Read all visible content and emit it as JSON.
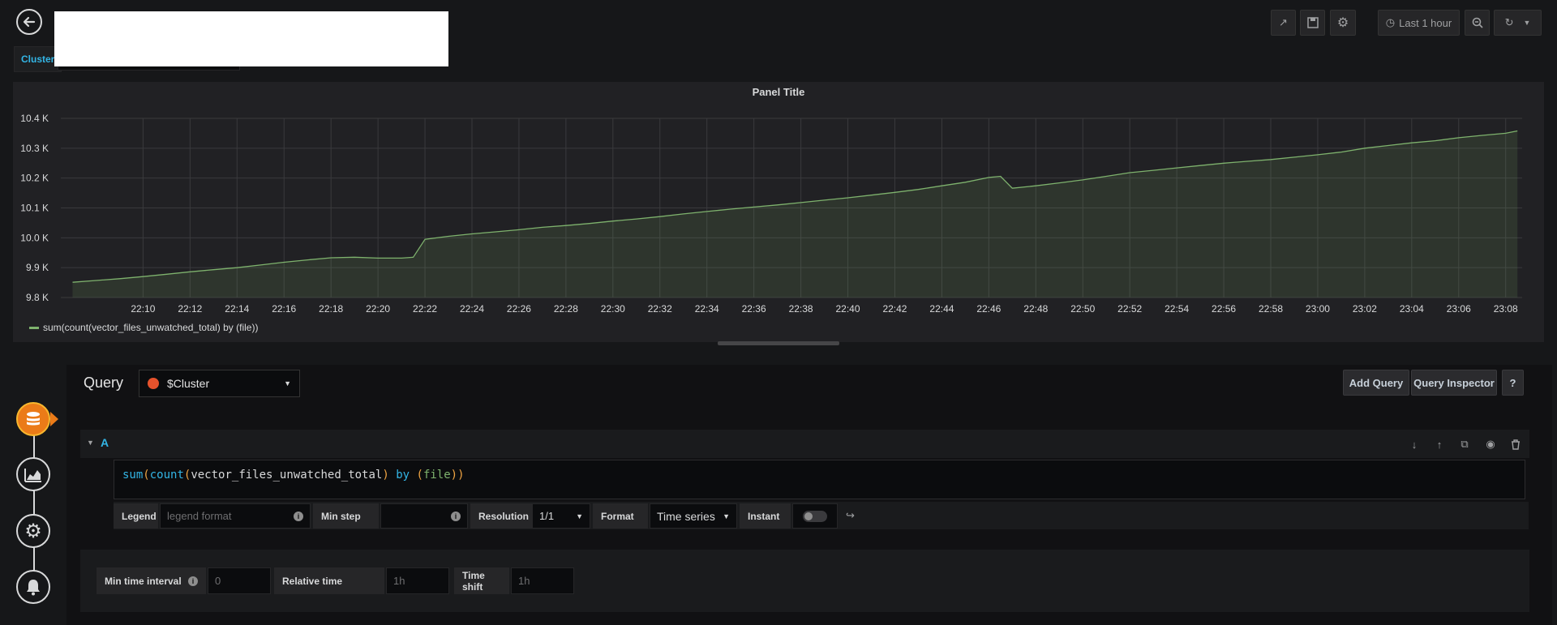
{
  "header": {
    "variable_label": "Cluster",
    "time_range_label": "Last 1 hour"
  },
  "panel": {
    "title": "Panel Title",
    "legend": "sum(count(vector_files_unwatched_total) by (file))"
  },
  "chart_data": {
    "type": "area",
    "title": "Panel Title",
    "y_ticks": [
      "9.8 K",
      "9.9 K",
      "10.0 K",
      "10.1 K",
      "10.2 K",
      "10.3 K",
      "10.4 K"
    ],
    "ylim": [
      9800,
      10400
    ],
    "x_ticks": [
      "22:10",
      "22:12",
      "22:14",
      "22:16",
      "22:18",
      "22:20",
      "22:22",
      "22:24",
      "22:26",
      "22:28",
      "22:30",
      "22:32",
      "22:34",
      "22:36",
      "22:38",
      "22:40",
      "22:42",
      "22:44",
      "22:46",
      "22:48",
      "22:50",
      "22:52",
      "22:54",
      "22:56",
      "22:58",
      "23:00",
      "23:02",
      "23:04",
      "23:06",
      "23:08"
    ],
    "grid": true,
    "legend_position": "bottom-left",
    "series": [
      {
        "name": "sum(count(vector_files_unwatched_total) by (file))",
        "color": "#7eb26d",
        "x": [
          "22:07",
          "22:08",
          "22:09",
          "22:10",
          "22:11",
          "22:12",
          "22:13",
          "22:14",
          "22:15",
          "22:16",
          "22:17",
          "22:18",
          "22:19",
          "22:20",
          "22:21",
          "22:21:30",
          "22:22",
          "22:23",
          "22:24",
          "22:25",
          "22:26",
          "22:27",
          "22:28",
          "22:29",
          "22:30",
          "22:31",
          "22:32",
          "22:33",
          "22:34",
          "22:35",
          "22:36",
          "22:37",
          "22:38",
          "22:39",
          "22:40",
          "22:41",
          "22:42",
          "22:43",
          "22:44",
          "22:45",
          "22:46",
          "22:46:30",
          "22:47",
          "22:48",
          "22:49",
          "22:50",
          "22:51",
          "22:52",
          "22:53",
          "22:54",
          "22:55",
          "22:56",
          "22:57",
          "22:58",
          "22:59",
          "23:00",
          "23:01",
          "23:02",
          "23:03",
          "23:04",
          "23:05",
          "23:06",
          "23:07",
          "23:08",
          "23:08:30"
        ],
        "values": [
          9851,
          9857,
          9863,
          9870,
          9878,
          9886,
          9893,
          9900,
          9909,
          9918,
          9926,
          9933,
          9935,
          9932,
          9932,
          9935,
          9995,
          10005,
          10013,
          10020,
          10027,
          10035,
          10041,
          10048,
          10056,
          10063,
          10071,
          10080,
          10088,
          10096,
          10103,
          10110,
          10118,
          10126,
          10134,
          10143,
          10152,
          10162,
          10174,
          10186,
          10202,
          10206,
          10166,
          10174,
          10184,
          10194,
          10206,
          10218,
          10226,
          10234,
          10242,
          10250,
          10256,
          10262,
          10270,
          10278,
          10287,
          10300,
          10309,
          10318,
          10325,
          10335,
          10343,
          10350,
          10358
        ]
      }
    ]
  },
  "editor": {
    "query_title": "Query",
    "datasource": "$Cluster",
    "add_query": "Add Query",
    "query_inspector": "Query Inspector",
    "help": "?",
    "row_letter": "A",
    "expr": {
      "fn1": "sum",
      "fn2": "count",
      "metric": "vector_files_unwatched_total",
      "by": "by",
      "label": "file"
    },
    "options": {
      "legend_label": "Legend",
      "legend_placeholder": "legend format",
      "min_step_label": "Min step",
      "resolution_label": "Resolution",
      "resolution_value": "1/1",
      "format_label": "Format",
      "format_value": "Time series",
      "instant_label": "Instant"
    },
    "query_options": {
      "min_interval_label": "Min time interval",
      "min_interval_placeholder": "0",
      "relative_time_label": "Relative time",
      "relative_time_placeholder": "1h",
      "time_shift_label": "Time shift",
      "time_shift_placeholder": "1h"
    }
  }
}
